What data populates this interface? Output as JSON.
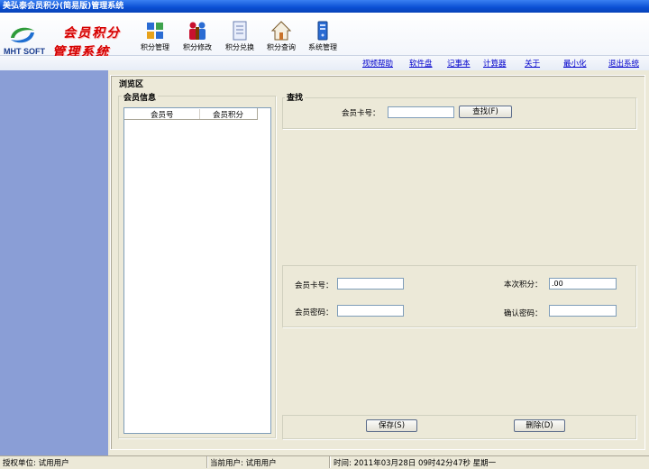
{
  "window": {
    "title": "美弘泰会员积分(简易版)管理系统"
  },
  "logo": {
    "brand": "MHT SOFT",
    "title_line1": "会员积分",
    "title_line2": "管理系统"
  },
  "toolbar": [
    {
      "label": "积分管理",
      "icon": "grid-icon"
    },
    {
      "label": "积分修改",
      "icon": "people-icon"
    },
    {
      "label": "积分兑换",
      "icon": "document-icon"
    },
    {
      "label": "积分查询",
      "icon": "home-icon"
    },
    {
      "label": "系统管理",
      "icon": "server-icon"
    }
  ],
  "links": [
    "视频帮助",
    "软件盘",
    "记事本",
    "计算器",
    "关于",
    "最小化",
    "退出系统"
  ],
  "browse": {
    "label": "浏览区"
  },
  "member_info": {
    "label": "会员信息",
    "columns": [
      "会员号",
      "会员积分"
    ]
  },
  "search": {
    "label": "查找",
    "card_label": "会员卡号：",
    "card_value": "",
    "button": "查找(F)"
  },
  "form": {
    "card_label": "会员卡号：",
    "card_value": "",
    "points_label": "本次积分：",
    "points_value": ".00",
    "password_label": "会员密码：",
    "password_value": "",
    "confirm_label": "确认密码：",
    "confirm_value": ""
  },
  "actions": {
    "save": "保存(S)",
    "delete": "删除(D)"
  },
  "status": {
    "org": "授权单位: 试用用户",
    "user": "当前用户: 试用用户",
    "time": "时间: 2011年03月28日  09时42分47秒  星期一"
  },
  "colors": {
    "left_panel": "#8a9ed6",
    "title_bar": "#0a4fd4",
    "logo_red": "#d40000"
  }
}
